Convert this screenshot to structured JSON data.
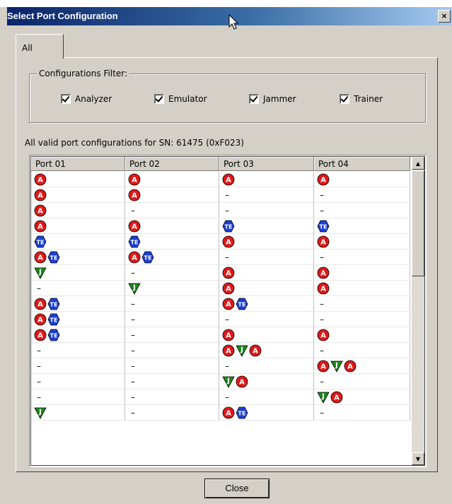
{
  "window": {
    "title": "Select Port Configuration",
    "close_glyph": "×"
  },
  "tabs": [
    {
      "label": "All"
    }
  ],
  "filter": {
    "legend": "Configurations Filter:",
    "options": [
      {
        "label": "Analyzer",
        "checked": true
      },
      {
        "label": "Emulator",
        "checked": true
      },
      {
        "label": "Jammer",
        "checked": true
      },
      {
        "label": "Trainer",
        "checked": true
      }
    ]
  },
  "sn_label": "All valid port configurations for  SN: 61475 (0xF023)",
  "grid": {
    "columns": [
      "Port 01",
      "Port 02",
      "Port 03",
      "Port 04"
    ],
    "legend_icons": {
      "A": "analyzer-icon",
      "TE": "trainer-emulator-icon",
      "J": "jammer-icon"
    },
    "rows": [
      [
        [
          "A"
        ],
        [
          "A"
        ],
        [
          "A"
        ],
        [
          "A"
        ]
      ],
      [
        [
          "A"
        ],
        [
          "A"
        ],
        [],
        []
      ],
      [
        [
          "A"
        ],
        [],
        [],
        []
      ],
      [
        [
          "A"
        ],
        [
          "A"
        ],
        [
          "TE"
        ],
        [
          "TE"
        ]
      ],
      [
        [
          "TE"
        ],
        [
          "TE"
        ],
        [
          "A"
        ],
        [
          "A"
        ]
      ],
      [
        [
          "A",
          "TE"
        ],
        [
          "A",
          "TE"
        ],
        [],
        []
      ],
      [
        [
          "J"
        ],
        [],
        [
          "A"
        ],
        [
          "A"
        ]
      ],
      [
        [],
        [
          "J"
        ],
        [
          "A"
        ],
        [
          "A"
        ]
      ],
      [
        [
          "A",
          "TE"
        ],
        [],
        [
          "A",
          "TE"
        ],
        []
      ],
      [
        [
          "A",
          "TE"
        ],
        [],
        [],
        []
      ],
      [
        [
          "A",
          "TE"
        ],
        [],
        [
          "A"
        ],
        [
          "A"
        ]
      ],
      [
        [],
        [],
        [
          "A",
          "J",
          "A"
        ],
        []
      ],
      [
        [],
        [],
        [],
        [
          "A",
          "J",
          "A"
        ]
      ],
      [
        [],
        [],
        [
          "J",
          "A"
        ],
        []
      ],
      [
        [],
        [],
        [],
        [
          "J",
          "A"
        ]
      ],
      [
        [
          "J"
        ],
        [],
        [
          "A",
          "TE"
        ],
        []
      ]
    ],
    "empty_text": "–",
    "colors": {
      "analyzer": "#e01818",
      "trainer": "#1a3fd6",
      "jammer": "#1e8a1e"
    }
  },
  "buttons": {
    "close": "Close"
  }
}
